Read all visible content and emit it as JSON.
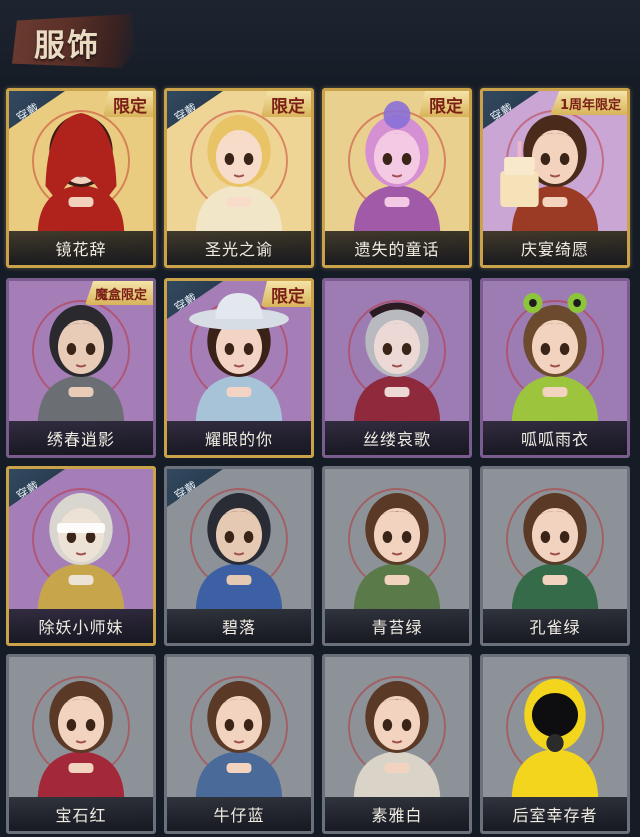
{
  "page": {
    "title": "服饰"
  },
  "badges": {
    "worn": "穿戴"
  },
  "cards": [
    {
      "name": "镜花辞",
      "frame": "gold",
      "worn": true,
      "tag": "限定",
      "theme": "red-hood"
    },
    {
      "name": "圣光之谕",
      "frame": "gold",
      "worn": true,
      "tag": "限定",
      "theme": "golden-hair"
    },
    {
      "name": "遗失的童话",
      "frame": "gold",
      "worn": false,
      "tag": "限定",
      "theme": "pink-fairy"
    },
    {
      "name": "庆宴绮愿",
      "frame": "gold",
      "worn": true,
      "tag": "1周年限定",
      "theme": "cake"
    },
    {
      "name": "绣春逍影",
      "frame": "purple",
      "worn": false,
      "tag": "魔盒限定",
      "theme": "dark-hair"
    },
    {
      "name": "耀眼的你",
      "frame": "purple-gold",
      "worn": true,
      "tag": "限定",
      "theme": "cowboy-hat"
    },
    {
      "name": "丝缕哀歌",
      "frame": "purple",
      "worn": false,
      "tag": "",
      "theme": "grey-lady"
    },
    {
      "name": "呱呱雨衣",
      "frame": "purple",
      "worn": false,
      "tag": "",
      "theme": "frog"
    },
    {
      "name": "除妖小师妹",
      "frame": "purple-gold",
      "worn": true,
      "tag": "",
      "theme": "blindfold"
    },
    {
      "name": "碧落",
      "frame": "grey",
      "worn": true,
      "tag": "",
      "theme": "boy-blue"
    },
    {
      "name": "青苔绿",
      "frame": "grey",
      "worn": false,
      "tag": "",
      "theme": "girl-green"
    },
    {
      "name": "孔雀绿",
      "frame": "grey",
      "worn": false,
      "tag": "",
      "theme": "girl-darkgreen"
    },
    {
      "name": "宝石红",
      "frame": "grey",
      "worn": false,
      "tag": "",
      "theme": "girl-red"
    },
    {
      "name": "牛仔蓝",
      "frame": "grey",
      "worn": false,
      "tag": "",
      "theme": "girl-blue"
    },
    {
      "name": "素雅白",
      "frame": "grey",
      "worn": false,
      "tag": "",
      "theme": "girl-white"
    },
    {
      "name": "后室幸存者",
      "frame": "grey",
      "worn": false,
      "tag": "",
      "theme": "hazmat"
    }
  ],
  "colors": {
    "background": "#161c26",
    "gold_frame": "#c9a24a",
    "purple_frame": "#7b5c8e",
    "grey_frame": "#6b717a",
    "limit_text": "#7a1f16"
  }
}
